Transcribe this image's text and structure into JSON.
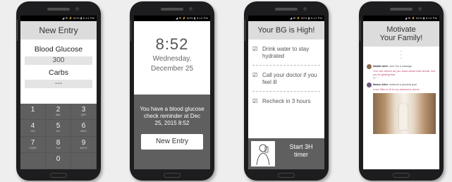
{
  "status": {
    "text": "◢ ✉ ⚡ 82% ▮ 5:14 PM"
  },
  "screen1": {
    "title": "New Entry",
    "field1_label": "Blood Glucose",
    "field1_value": "300",
    "field2_label": "Carbs",
    "field2_value": "---",
    "keys": [
      {
        "digit": "1",
        "letters": ""
      },
      {
        "digit": "2",
        "letters": "ABC"
      },
      {
        "digit": "3",
        "letters": "DEF"
      },
      {
        "digit": "4",
        "letters": "GHI"
      },
      {
        "digit": "5",
        "letters": "JKL"
      },
      {
        "digit": "6",
        "letters": "MNO"
      },
      {
        "digit": "7",
        "letters": "PQRS"
      },
      {
        "digit": "8",
        "letters": "TUV"
      },
      {
        "digit": "9",
        "letters": "WXYZ"
      },
      {
        "digit": "",
        "letters": ""
      },
      {
        "digit": "0",
        "letters": ""
      },
      {
        "digit": "",
        "letters": ""
      }
    ]
  },
  "screen2": {
    "time": "8:52",
    "date_line1": "Wednesday,",
    "date_line2": "December 25",
    "message": "You have a blood glucose check reminder at Dec 25, 2015 8:52",
    "button_label": "New Entry"
  },
  "screen3": {
    "title": "Your BG is High!",
    "items": [
      "Drink water to stay hydrated",
      "Call your doctor if you feel ill",
      "Recheck in 3 hours"
    ],
    "timer_line1": "Start 3H",
    "timer_line2": "timer"
  },
  "screen4": {
    "title_line1": "Motivate",
    "title_line2": "Your Family!",
    "post1_name": "Maddie Allen",
    "post1_action": "sent You a message",
    "post1_text": "You can dream all you want about that streak, but you're getting fish.",
    "post2_name": "Marion Allen",
    "post2_action": "achieved a personal goal",
    "post2_text": "Lose 5lbs to fit in my awesome dress"
  }
}
